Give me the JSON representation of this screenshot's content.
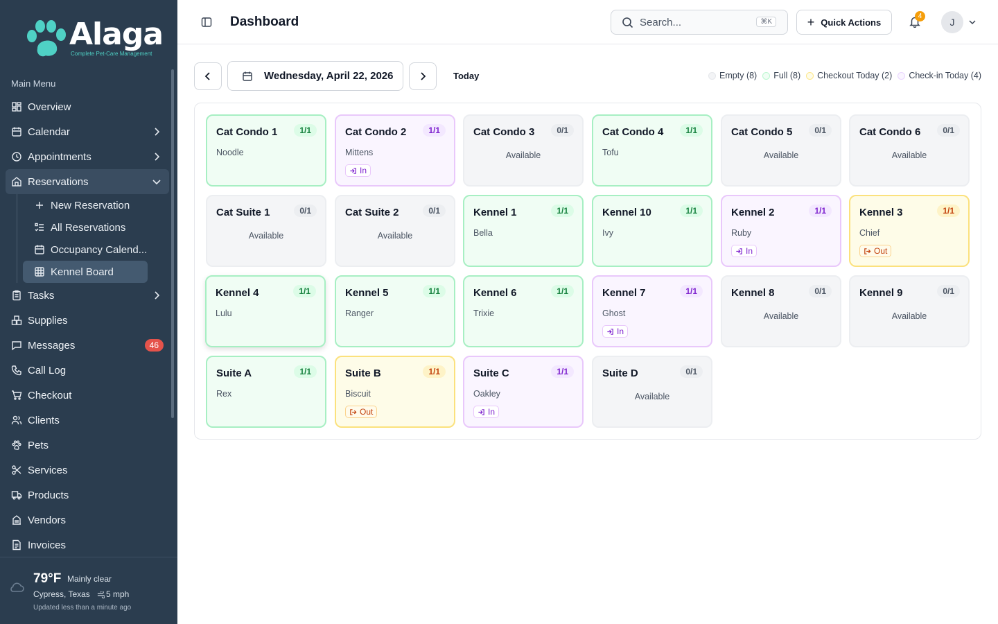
{
  "app": {
    "brand": "Alaga",
    "tagline": "Complete Pet-Care Management"
  },
  "sidebar": {
    "menu_title": "Main Menu",
    "items": [
      {
        "label": "Overview",
        "icon": "grid-icon"
      },
      {
        "label": "Calendar",
        "icon": "calendar-icon"
      },
      {
        "label": "Appointments",
        "icon": "clock-icon"
      },
      {
        "label": "Reservations",
        "icon": "home-icon"
      },
      {
        "label": "Tasks",
        "icon": "clipboard-icon"
      },
      {
        "label": "Supplies",
        "icon": "boxes-icon"
      },
      {
        "label": "Messages",
        "icon": "message-icon",
        "badge": "46"
      },
      {
        "label": "Call Log",
        "icon": "phone-icon"
      },
      {
        "label": "Checkout",
        "icon": "cart-icon"
      },
      {
        "label": "Clients",
        "icon": "users-icon"
      },
      {
        "label": "Pets",
        "icon": "paw-icon"
      },
      {
        "label": "Services",
        "icon": "scissors-icon"
      },
      {
        "label": "Products",
        "icon": "truck-icon"
      },
      {
        "label": "Vendors",
        "icon": "building-icon"
      },
      {
        "label": "Invoices",
        "icon": "file-icon"
      }
    ],
    "reservations_sub": [
      {
        "label": "New Reservation"
      },
      {
        "label": "All Reservations"
      },
      {
        "label": "Occupancy Calend..."
      },
      {
        "label": "Kennel Board"
      }
    ]
  },
  "weather": {
    "temp": "79°F",
    "condition": "Mainly clear",
    "location": "Cypress, Texas",
    "wind": "5 mph",
    "updated": "Updated less than a minute ago"
  },
  "header": {
    "title": "Dashboard",
    "search_placeholder": "Search...",
    "search_shortcut": "⌘K",
    "quick_actions": "Quick Actions",
    "notification_count": "4",
    "avatar_initial": "J"
  },
  "toolbar": {
    "date": "Wednesday, April 22, 2026",
    "today": "Today"
  },
  "legend": [
    {
      "label": "Empty (8)",
      "color": "#e5e7eb"
    },
    {
      "label": "Full (8)",
      "color": "#bbf7d0"
    },
    {
      "label": "Checkout Today (2)",
      "color": "#fde68a"
    },
    {
      "label": "Check-in Today (4)",
      "color": "#e9d5ff"
    }
  ],
  "colors": {
    "sidebar_bg": "#2b3d4f",
    "brand_teal": "#4fd1c5",
    "badge_red": "#e5534b",
    "bell_badge": "#f59e0b"
  },
  "kennels": [
    {
      "name": "Cat Condo 1",
      "capacity": "1/1",
      "status": "full",
      "pet": "Noodle",
      "tag": ""
    },
    {
      "name": "Cat Condo 2",
      "capacity": "1/1",
      "status": "checkin",
      "pet": "Mittens",
      "tag": "In"
    },
    {
      "name": "Cat Condo 3",
      "capacity": "0/1",
      "status": "empty",
      "pet": "",
      "tag": "",
      "available": "Available"
    },
    {
      "name": "Cat Condo 4",
      "capacity": "1/1",
      "status": "full",
      "pet": "Tofu",
      "tag": ""
    },
    {
      "name": "Cat Condo 5",
      "capacity": "0/1",
      "status": "empty",
      "pet": "",
      "tag": "",
      "available": "Available"
    },
    {
      "name": "Cat Condo 6",
      "capacity": "0/1",
      "status": "empty",
      "pet": "",
      "tag": "",
      "available": "Available"
    },
    {
      "name": "Cat Suite 1",
      "capacity": "0/1",
      "status": "empty",
      "pet": "",
      "tag": "",
      "available": "Available"
    },
    {
      "name": "Cat Suite 2",
      "capacity": "0/1",
      "status": "empty",
      "pet": "",
      "tag": "",
      "available": "Available"
    },
    {
      "name": "Kennel 1",
      "capacity": "1/1",
      "status": "full",
      "pet": "Bella",
      "tag": ""
    },
    {
      "name": "Kennel 10",
      "capacity": "1/1",
      "status": "full",
      "pet": "Ivy",
      "tag": ""
    },
    {
      "name": "Kennel 2",
      "capacity": "1/1",
      "status": "checkin",
      "pet": "Ruby",
      "tag": "In"
    },
    {
      "name": "Kennel 3",
      "capacity": "1/1",
      "status": "checkout",
      "pet": "Chief",
      "tag": "Out"
    },
    {
      "name": "Kennel 4",
      "capacity": "1/1",
      "status": "full",
      "pet": "Lulu",
      "tag": "",
      "lifted": true
    },
    {
      "name": "Kennel 5",
      "capacity": "1/1",
      "status": "full",
      "pet": "Ranger",
      "tag": ""
    },
    {
      "name": "Kennel 6",
      "capacity": "1/1",
      "status": "full",
      "pet": "Trixie",
      "tag": ""
    },
    {
      "name": "Kennel 7",
      "capacity": "1/1",
      "status": "checkin",
      "pet": "Ghost",
      "tag": "In"
    },
    {
      "name": "Kennel 8",
      "capacity": "0/1",
      "status": "empty",
      "pet": "",
      "tag": "",
      "available": "Available"
    },
    {
      "name": "Kennel 9",
      "capacity": "0/1",
      "status": "empty",
      "pet": "",
      "tag": "",
      "available": "Available"
    },
    {
      "name": "Suite A",
      "capacity": "1/1",
      "status": "full",
      "pet": "Rex",
      "tag": ""
    },
    {
      "name": "Suite B",
      "capacity": "1/1",
      "status": "checkout",
      "pet": "Biscuit",
      "tag": "Out"
    },
    {
      "name": "Suite C",
      "capacity": "1/1",
      "status": "checkin",
      "pet": "Oakley",
      "tag": "In"
    },
    {
      "name": "Suite D",
      "capacity": "0/1",
      "status": "empty",
      "pet": "",
      "tag": "",
      "available": "Available"
    }
  ]
}
